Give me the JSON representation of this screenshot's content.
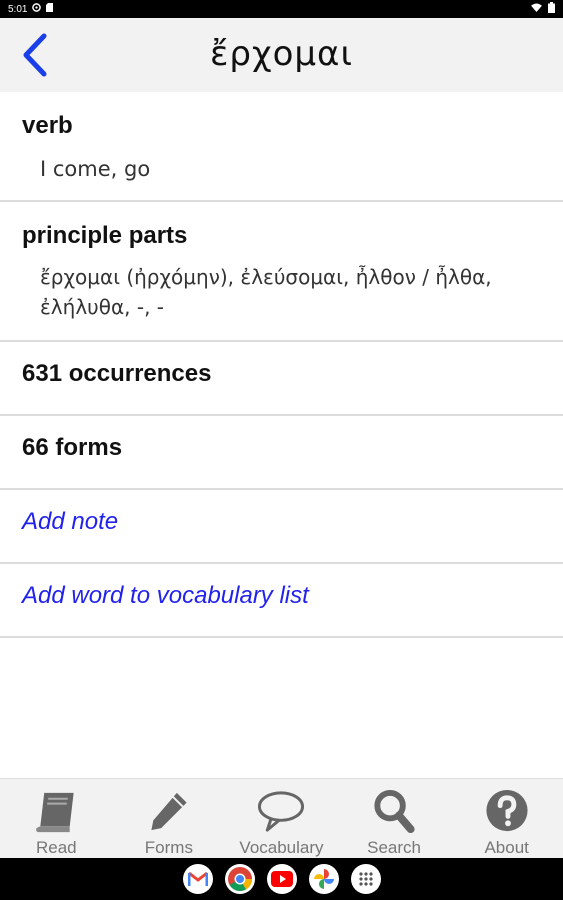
{
  "status_bar": {
    "time": "5:01"
  },
  "header": {
    "title": "ἔρχομαι"
  },
  "sections": {
    "part_of_speech": {
      "title": "verb",
      "gloss": "I come, go"
    },
    "principal_parts": {
      "title": "principle parts",
      "line1": "ἔρχομαι (ἠρχόμην), ἐλεύσομαι, ἦλθον / ἦλθα,",
      "line2": "ἐλήλυθα, -, -"
    },
    "occurrences": {
      "label": "631 occurrences"
    },
    "forms": {
      "label": "66 forms"
    },
    "add_note": {
      "label": "Add note"
    },
    "add_vocab": {
      "label": "Add word to vocabulary list"
    }
  },
  "tabs": [
    {
      "label": "Read",
      "icon": "book-icon"
    },
    {
      "label": "Forms",
      "icon": "pencil-icon"
    },
    {
      "label": "Vocabulary",
      "icon": "speech-bubble-icon"
    },
    {
      "label": "Search",
      "icon": "search-icon"
    },
    {
      "label": "About",
      "icon": "question-icon"
    }
  ],
  "colors": {
    "link": "#2222ee",
    "back_arrow": "#1a3ee8",
    "tab_icon": "#666666"
  },
  "nav_apps": [
    "gmail-icon",
    "chrome-icon",
    "youtube-icon",
    "photos-icon",
    "app-drawer-icon"
  ]
}
